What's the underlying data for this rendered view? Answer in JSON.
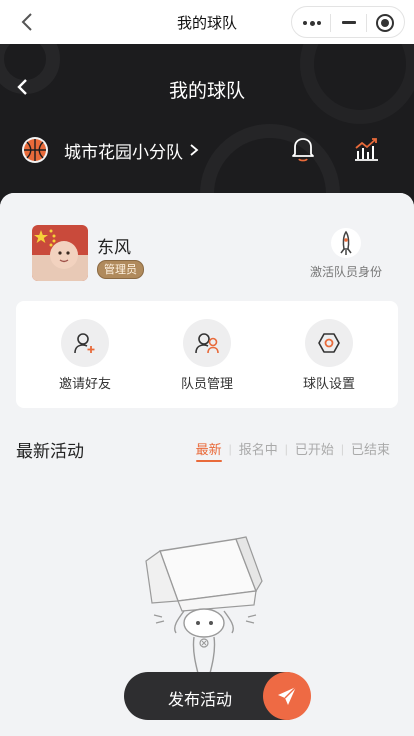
{
  "system_bar": {
    "title": "我的球队"
  },
  "header": {
    "title": "我的球队",
    "team_name": "城市花园小分队"
  },
  "profile": {
    "name": "东风",
    "role": "管理员",
    "activate_label": "激活队员身份"
  },
  "actions": [
    {
      "label": "邀请好友",
      "icon": "add-user-icon"
    },
    {
      "label": "队员管理",
      "icon": "user-manage-icon"
    },
    {
      "label": "球队设置",
      "icon": "settings-hexagon-icon"
    }
  ],
  "activities": {
    "title": "最新活动",
    "tabs": [
      "最新",
      "报名中",
      "已开始",
      "已结束"
    ],
    "active_tab": "最新"
  },
  "publish": {
    "label": "发布活动"
  },
  "colors": {
    "accent": "#e96a3a",
    "header_bg": "#1c1c1e",
    "badge": "#b08a5c"
  }
}
